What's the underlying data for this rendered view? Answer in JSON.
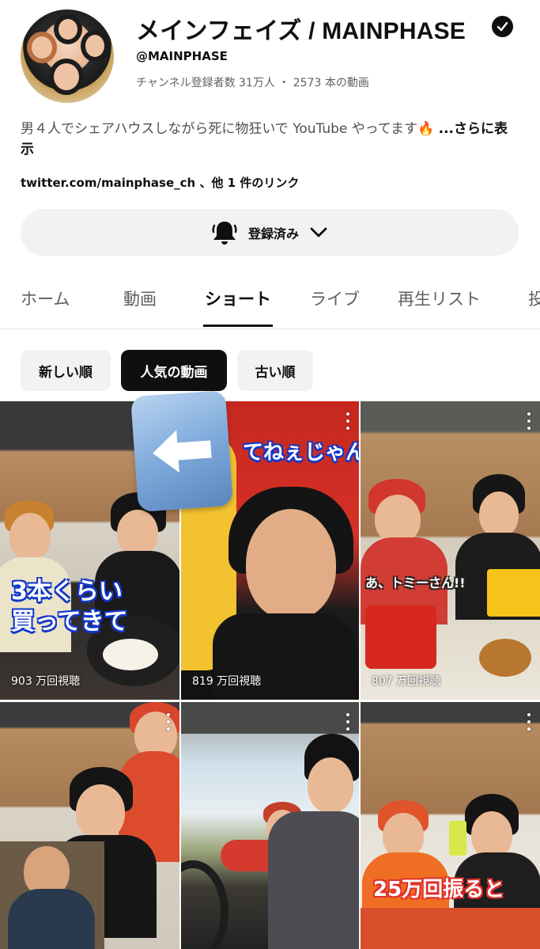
{
  "channel": {
    "name": "メインフェイズ / MAINPHASE",
    "handle": "@MAINPHASE",
    "stats": "チャンネル登録者数 31万人 ・ 2573 本の動画",
    "description": "男４人でシェアハウスしながら死に物狂いで YouTube やってます🔥 ",
    "description_more": "...さらに表示",
    "links": "twitter.com/mainphase_ch 、他 1 件のリンク",
    "subscribe_label": "登録済み"
  },
  "tabs": [
    {
      "label": "ホーム",
      "active": false
    },
    {
      "label": "動画",
      "active": false
    },
    {
      "label": "ショート",
      "active": true
    },
    {
      "label": "ライブ",
      "active": false
    },
    {
      "label": "再生リスト",
      "active": false
    },
    {
      "label": "投",
      "active": false
    }
  ],
  "chips": [
    {
      "label": "新しい順",
      "selected": false
    },
    {
      "label": "人気の動画",
      "selected": true
    },
    {
      "label": "古い順",
      "selected": false
    }
  ],
  "shorts": [
    {
      "views": "903 万回視聴",
      "caption": "3本くらい\n買ってきて"
    },
    {
      "views": "819 万回視聴",
      "caption": "てねぇじゃん"
    },
    {
      "views": "807 万回視聴",
      "caption": "あ、トミーさん!!"
    },
    {
      "views": "",
      "caption": ""
    },
    {
      "views": "",
      "caption": ""
    },
    {
      "views": "",
      "caption": "25万回振ると"
    }
  ],
  "colors": {
    "text_primary": "#0f0f0f",
    "text_secondary": "#606060",
    "chip_bg": "#f2f2f2",
    "chip_selected_bg": "#0f0f0f",
    "caption_outline": "#1237c9"
  },
  "icons": [
    "verified-icon",
    "bell-icon",
    "chevron-down-icon",
    "more-vert-icon",
    "left-arrow-icon"
  ]
}
